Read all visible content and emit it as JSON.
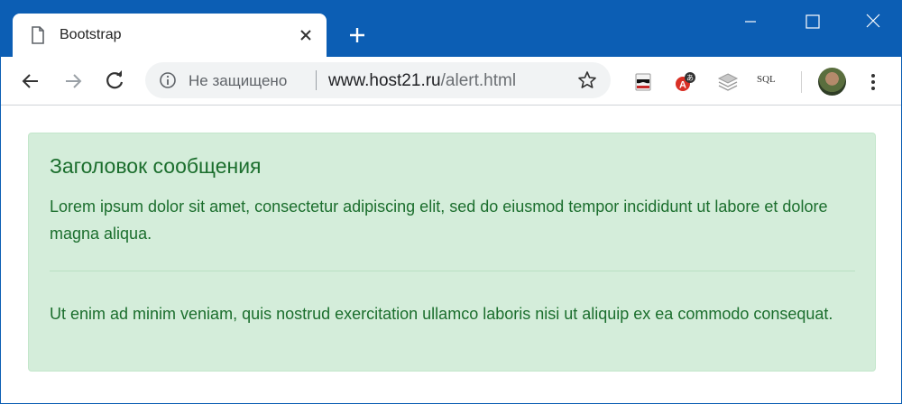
{
  "tab": {
    "title": "Bootstrap",
    "icon": "document-icon"
  },
  "toolbar": {
    "security_label": "Не защищено",
    "url_host": "www.host21.ru",
    "url_path": "/alert.html",
    "ext_sql_label": "SQL"
  },
  "alert": {
    "heading": "Заголовок сообщения",
    "paragraph1": "Lorem ipsum dolor sit amet, consectetur adipiscing elit, sed do eiusmod tempor incididunt ut labore et dolore magna aliqua.",
    "paragraph2": "Ut enim ad minim veniam, quis nostrud exercitation ullamco laboris nisi ut aliquip ex ea commodo consequat."
  },
  "colors": {
    "titlebar": "#0c5eb4",
    "alert_bg": "#d4edda",
    "alert_text": "#1b6e2d"
  }
}
